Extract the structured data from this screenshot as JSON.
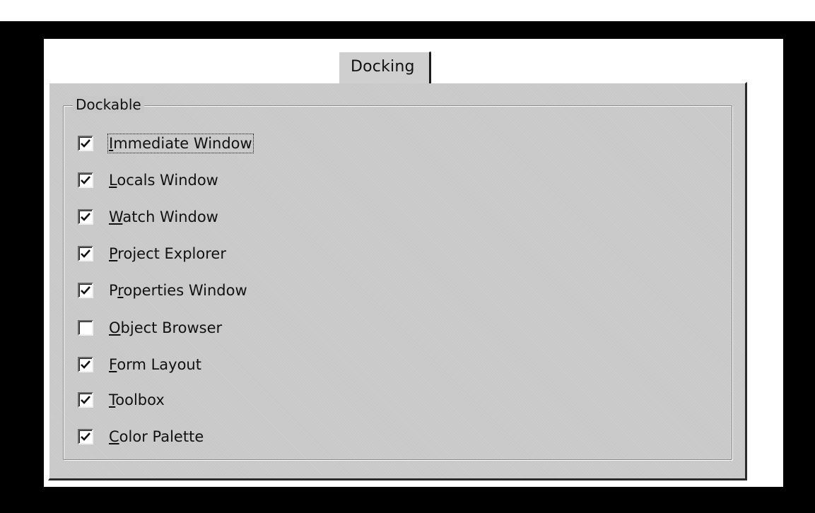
{
  "tab": {
    "label": "Docking"
  },
  "group": {
    "label": "Dockable"
  },
  "options": [
    {
      "pre": "",
      "accel": "I",
      "post": "mmediate Window",
      "checked": true,
      "focused": true
    },
    {
      "pre": "",
      "accel": "L",
      "post": "ocals Window",
      "checked": true,
      "focused": false
    },
    {
      "pre": "",
      "accel": "W",
      "post": "atch Window",
      "checked": true,
      "focused": false
    },
    {
      "pre": "",
      "accel": "P",
      "post": "roject Explorer",
      "checked": true,
      "focused": false
    },
    {
      "pre": "P",
      "accel": "r",
      "post": "operties Window",
      "checked": true,
      "focused": false
    },
    {
      "pre": "",
      "accel": "O",
      "post": "bject Browser",
      "checked": false,
      "focused": false
    },
    {
      "pre": "",
      "accel": "F",
      "post": "orm Layout",
      "checked": true,
      "focused": false
    },
    {
      "pre": "",
      "accel": "T",
      "post": "oolbox",
      "checked": true,
      "focused": false
    },
    {
      "pre": "",
      "accel": "C",
      "post": "olor Palette",
      "checked": true,
      "focused": false
    }
  ]
}
